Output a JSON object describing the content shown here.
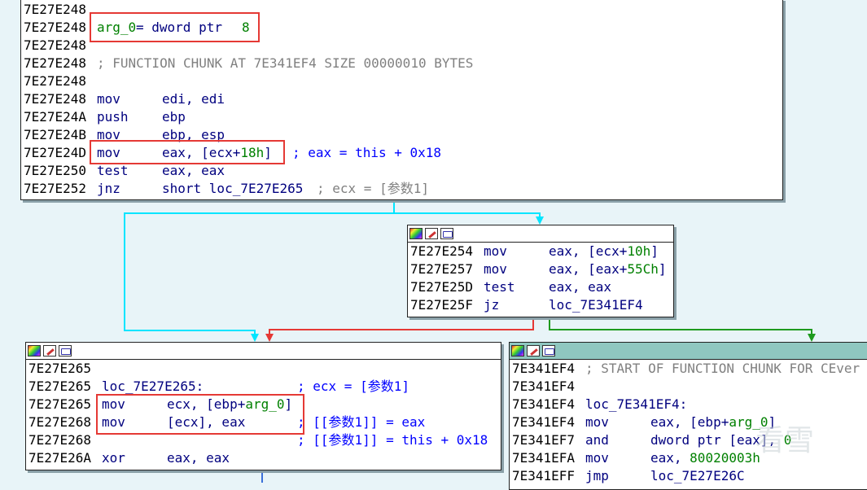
{
  "node_top": {
    "lines": [
      {
        "addr": "7E27E248"
      },
      {
        "addr": "7E27E248",
        "var": "arg_0",
        "rest": "= dword ptr  ",
        "num": "8"
      },
      {
        "addr": "7E27E248"
      },
      {
        "addr": "7E27E248",
        "comment": "; FUNCTION CHUNK AT 7E341EF4 SIZE 00000010 BYTES"
      },
      {
        "addr": "7E27E248"
      },
      {
        "addr": "7E27E248",
        "mn": "mov",
        "ops": "edi, edi"
      },
      {
        "addr": "7E27E24A",
        "mn": "push",
        "ops": "ebp"
      },
      {
        "addr": "7E27E24B",
        "mn": "mov",
        "ops": "ebp, esp"
      },
      {
        "addr": "7E27E24D",
        "mn": "mov",
        "ops_pre": "eax, [ecx+",
        "ops_num": "18h",
        "ops_post": "]",
        "bcomment": "; eax = this + 0x18"
      },
      {
        "addr": "7E27E250",
        "mn": "test",
        "ops": "eax, eax"
      },
      {
        "addr": "7E27E252",
        "mn": "jnz",
        "ops": "short loc_7E27E265",
        "comment": "; ecx = [参数1]"
      }
    ]
  },
  "node_mid": {
    "lines": [
      {
        "addr": "7E27E254",
        "mn": "mov",
        "ops_pre": "eax, [ecx+",
        "ops_num": "10h",
        "ops_post": "]"
      },
      {
        "addr": "7E27E257",
        "mn": "mov",
        "ops_pre": "eax, [eax+",
        "ops_num": "55Ch",
        "ops_post": "]"
      },
      {
        "addr": "7E27E25D",
        "mn": "test",
        "ops": "eax, eax"
      },
      {
        "addr": "7E27E25F",
        "mn": "jz",
        "ops": "loc_7E341EF4"
      }
    ]
  },
  "node_left": {
    "lines": [
      {
        "addr": "7E27E265"
      },
      {
        "addr": "7E27E265",
        "label": "loc_7E27E265:",
        "bcomment": "; ecx = [参数1]"
      },
      {
        "addr": "7E27E265",
        "mn": "mov",
        "ops_pre": "ecx, [ebp+",
        "ops_var": "arg_0",
        "ops_post": "]"
      },
      {
        "addr": "7E27E268",
        "mn": "mov",
        "ops": "[ecx], eax",
        "bcomment": "; [[参数1]] = eax"
      },
      {
        "addr": "7E27E268",
        "bcomment": "; [[参数1]] = this + 0x18"
      },
      {
        "addr": "7E27E26A",
        "mn": "xor",
        "ops": "eax, eax"
      }
    ]
  },
  "node_right": {
    "lines": [
      {
        "addr": "7E341EF4",
        "comment": "; START OF FUNCTION CHUNK FOR CEver"
      },
      {
        "addr": "7E341EF4"
      },
      {
        "addr": "7E341EF4",
        "label": "loc_7E341EF4:"
      },
      {
        "addr": "7E341EF4",
        "mn": "mov",
        "ops_pre": "eax, [ebp+",
        "ops_var": "arg_0",
        "ops_post": "]"
      },
      {
        "addr": "7E341EF7",
        "mn": "and",
        "ops_pre": "dword ptr [eax], ",
        "ops_num": "0",
        "ops_post": ""
      },
      {
        "addr": "7E341EFA",
        "mn": "mov",
        "ops_pre": "eax, ",
        "ops_num": "80020003h",
        "ops_post": ""
      },
      {
        "addr": "7E341EFF",
        "mn": "jmp",
        "ops": "loc_7E27E26C"
      }
    ]
  },
  "watermark": "看雪",
  "colors": {
    "edge_true": "#00e5ff",
    "edge_false": "#e53935",
    "edge_green": "#1e9a1e",
    "highlight": "#e53935"
  }
}
